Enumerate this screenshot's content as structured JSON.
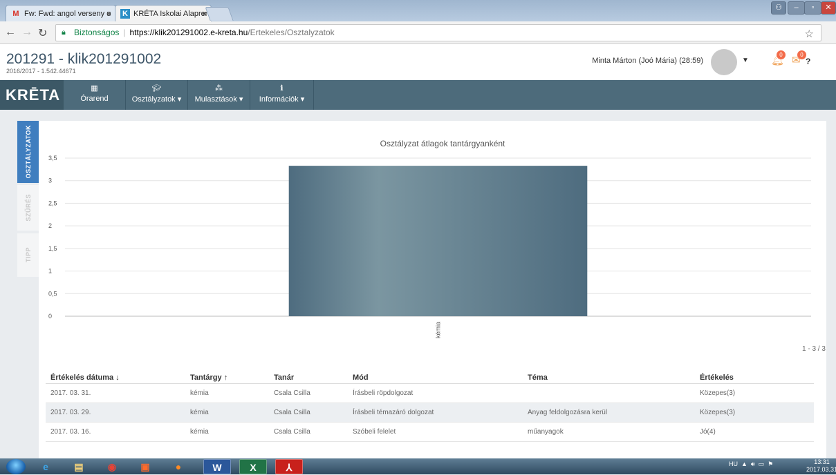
{
  "browser": {
    "tabs": [
      {
        "title": "Fw: Fwd: angol verseny o",
        "favicon": "M",
        "close": "×"
      },
      {
        "title": "KRÉTA Iskolai Alaprends",
        "favicon": "K",
        "close": "×"
      }
    ],
    "address": {
      "secure_label": "Biztonságos",
      "host": "https://klik201291002.e-kreta.hu",
      "path": "/Ertekeles/Osztalyzatok"
    }
  },
  "header": {
    "title": "201291 - klik201291002",
    "subtitle": "2016/2017 - 1.542.44671",
    "user": "Minta Márton (Joó Mária) (28:59)",
    "notif_count_1": "0",
    "notif_count_2": "0",
    "help": "?"
  },
  "navbar": {
    "logo": "KRĒTA",
    "items": [
      {
        "label": "Órarend",
        "icon": "calendar-icon"
      },
      {
        "label": "Osztályzatok ▾",
        "icon": "graduation-cap-icon"
      },
      {
        "label": "Mulasztások ▾",
        "icon": "spinner-icon"
      },
      {
        "label": "Információk ▾",
        "icon": "info-icon"
      }
    ]
  },
  "sidetabs": [
    "OSZTÁLYZATOK",
    "SZŰRÉS",
    "TIPP"
  ],
  "chart_data": {
    "type": "bar",
    "title": "Osztályzat átlagok tantárgyanként",
    "categories": [
      "kémia"
    ],
    "values": [
      3.33
    ],
    "ylim": [
      0,
      3.5
    ],
    "yticks": [
      "0",
      "0,5",
      "1",
      "1,5",
      "2",
      "2,5",
      "3",
      "3,5"
    ],
    "grid": true,
    "colors": {
      "bar_edge": "#4e6c7f",
      "bar_center": "#7b96a1"
    }
  },
  "pager": "1 - 3 / 3",
  "table": {
    "headers": [
      "Értékelés dátuma ↓",
      "Tantárgy ↑",
      "Tanár",
      "Mód",
      "Téma",
      "Értékelés"
    ],
    "rows": [
      [
        "2017. 03. 31.",
        "kémia",
        "Csala Csilla",
        "Írásbeli röpdolgozat",
        "",
        "Közepes(3)"
      ],
      [
        "2017. 03. 29.",
        "kémia",
        "Csala Csilla",
        "Írásbeli témazáró dolgozat",
        "Anyag feldolgozásra kerül",
        "Közepes(3)"
      ],
      [
        "2017. 03. 16.",
        "kémia",
        "Csala Csilla",
        "Szóbeli felelet",
        "műanyagok",
        "Jó(4)"
      ]
    ]
  },
  "taskbar": {
    "tray": "HU",
    "time": "13:31",
    "date": "2017.03.31"
  }
}
